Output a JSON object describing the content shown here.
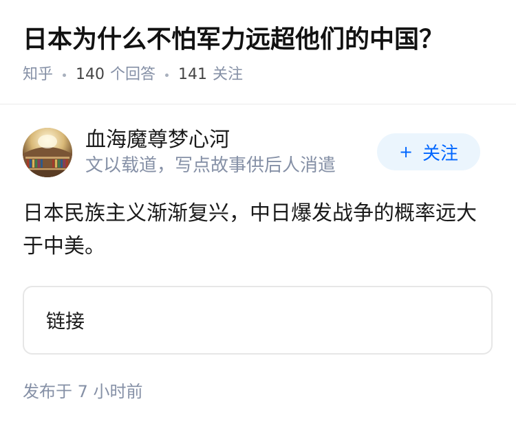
{
  "question": {
    "title": "日本为什么不怕军力远超他们的中国？",
    "source": "知乎",
    "answer_count": "140",
    "answer_label": "个回答",
    "follower_count": "141",
    "follower_label": "关注"
  },
  "author": {
    "name": "血海魔尊梦心河",
    "bio": "文以载道，写点故事供后人消遣",
    "avatar_icon": "library-avatar",
    "follow_button": {
      "plus": "+",
      "label": "关注"
    }
  },
  "answer": {
    "text": "日本民族主义渐渐复兴，中日爆发战争的概率远大于中美。",
    "link_card_label": "链接",
    "publish_label": "发布于",
    "publish_time": "7 小时前"
  },
  "colors": {
    "title": "#121212",
    "meta": "#8590a6",
    "accent": "#0066ff",
    "follow_bg": "#ebf5fd",
    "divider": "#ebebeb",
    "card_border": "#e6e6e6"
  }
}
